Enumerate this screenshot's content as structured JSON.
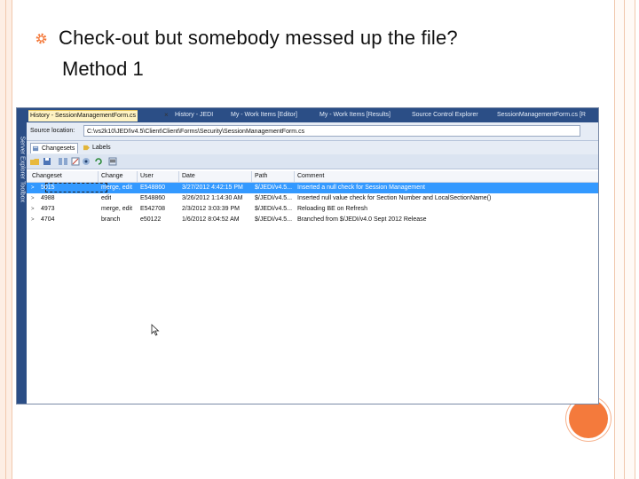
{
  "slide": {
    "title": "Check-out but somebody messed up the file?",
    "subtitle": "Method 1",
    "accent_color": "#f47a3c",
    "bullet_icon": "gear-bullet-icon"
  },
  "window": {
    "side_strip_label": "Server Explorer  Toolbox",
    "tabs": [
      {
        "label": "History - SessionManagementForm.cs",
        "active": true
      },
      {
        "label": "History - JEDI",
        "active": false
      },
      {
        "label": "My - Work Items [Editor]",
        "active": false
      },
      {
        "label": "My - Work Items [Results]",
        "active": false
      },
      {
        "label": "Source Control Explorer",
        "active": false
      },
      {
        "label": "SessionManagementForm.cs [R",
        "active": false
      }
    ],
    "close_glyph": "×",
    "source_location_label": "Source location:",
    "source_location_value": "C:\\vs2k10\\JEDI\\v4.5\\Client\\Client\\Forms\\Security\\SessionManagementForm.cs",
    "view_tabs": [
      {
        "label": "Changesets",
        "active": true
      },
      {
        "label": "Labels",
        "active": false
      }
    ],
    "toolbar_icons": [
      "open-folder-icon",
      "save-icon",
      "compare-icon",
      "annotate-icon",
      "view-icon",
      "refresh-icon",
      "properties-icon"
    ],
    "grid": {
      "columns": [
        "Changeset",
        "Change",
        "User",
        "Date",
        "Path",
        "Comment"
      ],
      "rows": [
        {
          "changeset": "5015",
          "change": "merge, edit",
          "user": "E548860",
          "date": "3/27/2012 4:42:15 PM",
          "path": "$/JEDI/v4.5...",
          "comment": "Inserted a null check for Session Management",
          "selected": true
        },
        {
          "changeset": "4988",
          "change": "edit",
          "user": "E548860",
          "date": "3/26/2012 1:14:30 AM",
          "path": "$/JEDI/v4.5...",
          "comment": "Inserted null value check for Section Number and LocalSectionName()",
          "selected": false
        },
        {
          "changeset": "4973",
          "change": "merge, edit",
          "user": "E542708",
          "date": "2/3/2012 3:03:39 PM",
          "path": "$/JEDI/v4.5...",
          "comment": "Reloading BE on Refresh",
          "selected": false
        },
        {
          "changeset": "4704",
          "change": "branch",
          "user": "e50122",
          "date": "1/6/2012 8:04:52 AM",
          "path": "$/JEDI/v4.5...",
          "comment": "Branched from $/JEDI/v4.0 Sept 2012 Release",
          "selected": false
        }
      ]
    }
  }
}
